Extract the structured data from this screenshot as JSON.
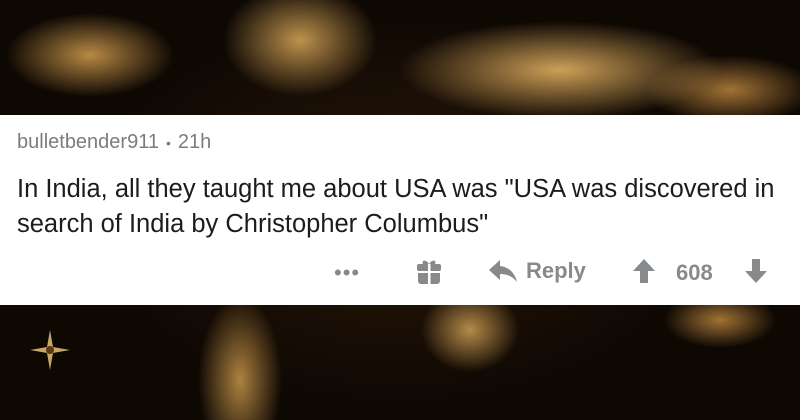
{
  "comment": {
    "username": "bulletbender911",
    "separator": "•",
    "age": "21h",
    "text": "In India, all they taught me about USA was \"USA was discovered in search of India by Christopher Columbus\""
  },
  "actions": {
    "more": "•••",
    "reply_label": "Reply",
    "score": "608"
  },
  "icons": {
    "gift": "gift-icon",
    "reply": "reply-arrow-icon",
    "upvote": "upvote-arrow-icon",
    "downvote": "downvote-arrow-icon"
  },
  "colors": {
    "card_background": "#ffffff",
    "meta_text": "#7c7c7c",
    "body_text": "#1c1c1c",
    "action_gray": "#878a8c"
  }
}
